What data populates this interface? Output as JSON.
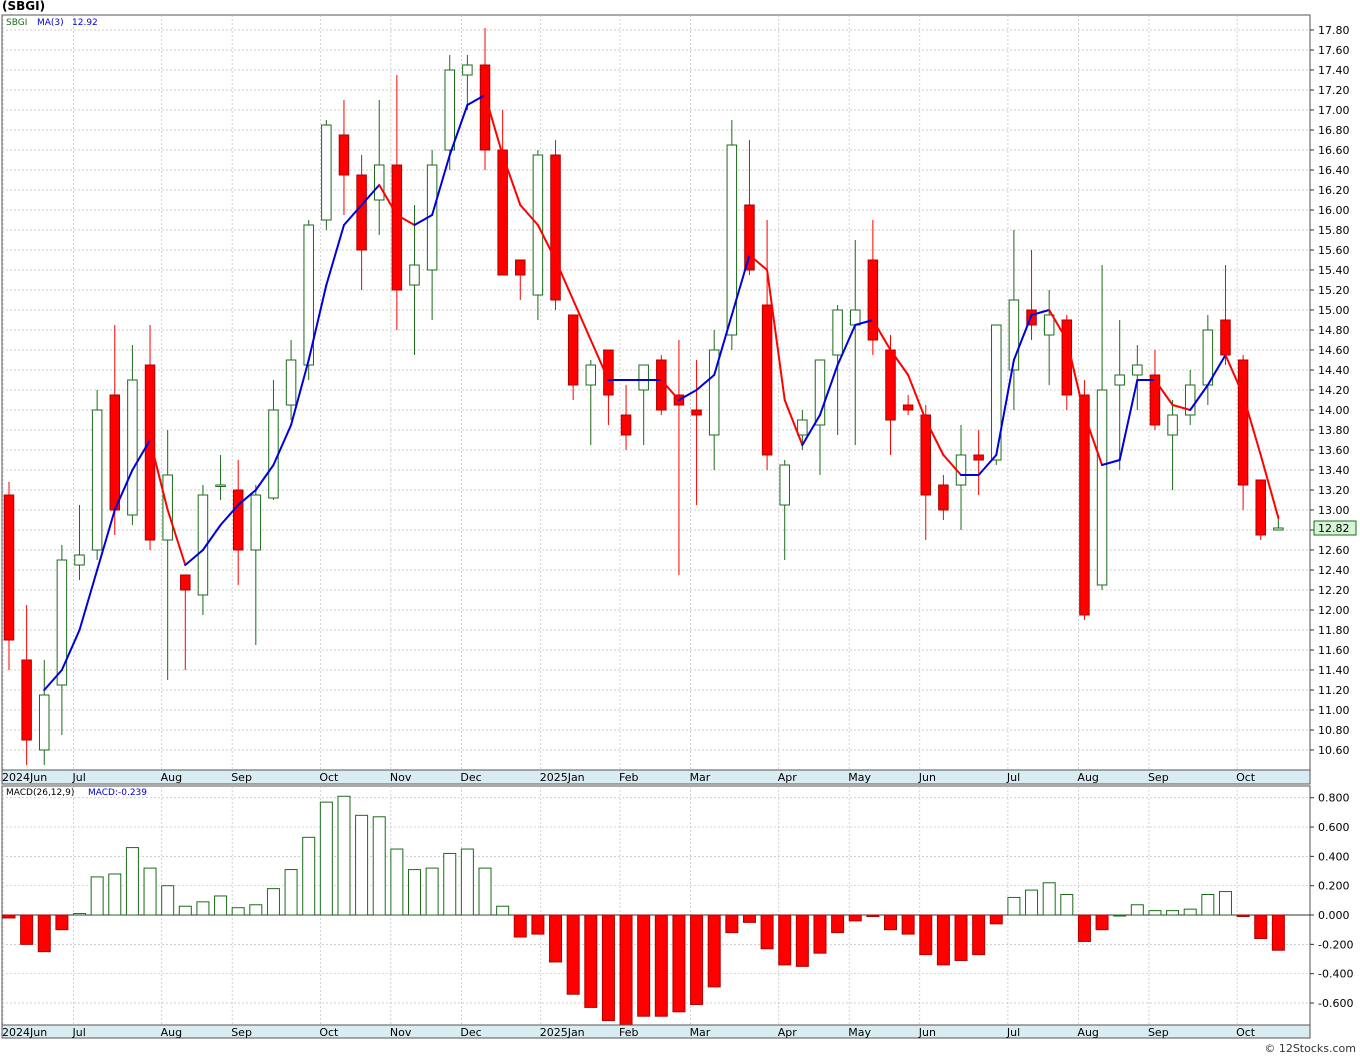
{
  "header": {
    "title": "(SBGI)"
  },
  "footer": {
    "credit": "© 12Stocks.com"
  },
  "colors": {
    "up": "#1b6b1b",
    "down": "#ff0000",
    "ma_up": "#0000dd",
    "ma_down": "#ff0000",
    "grid": "#bfbfbf",
    "axis_band": "#d9ecf2"
  },
  "chart_data": [
    {
      "type": "candlestick",
      "title": "",
      "legend": {
        "symbol": "SBGI",
        "indicator": "MA(3)",
        "value": "12.92"
      },
      "last_price_label": "12.82",
      "ylim": [
        10.4,
        17.95
      ],
      "y_ticks": [
        "10.60",
        "10.80",
        "11.00",
        "11.20",
        "11.40",
        "11.60",
        "11.80",
        "12.00",
        "12.20",
        "12.40",
        "12.60",
        "12.80",
        "13.00",
        "13.20",
        "13.40",
        "13.60",
        "13.80",
        "14.00",
        "14.20",
        "14.40",
        "14.60",
        "14.80",
        "15.00",
        "15.20",
        "15.40",
        "15.60",
        "15.80",
        "16.00",
        "16.20",
        "16.40",
        "16.60",
        "16.80",
        "17.00",
        "17.20",
        "17.40",
        "17.60",
        "17.80"
      ],
      "x_labels": [
        {
          "label": "2024Jun",
          "week": 0
        },
        {
          "label": "Jul",
          "week": 4
        },
        {
          "label": "Aug",
          "week": 9
        },
        {
          "label": "Sep",
          "week": 13
        },
        {
          "label": "Oct",
          "week": 18
        },
        {
          "label": "Nov",
          "week": 22
        },
        {
          "label": "Dec",
          "week": 26
        },
        {
          "label": "2025Jan",
          "week": 30.5
        },
        {
          "label": "Feb",
          "week": 35
        },
        {
          "label": "Mar",
          "week": 39
        },
        {
          "label": "Apr",
          "week": 44
        },
        {
          "label": "May",
          "week": 48
        },
        {
          "label": "Jun",
          "week": 52
        },
        {
          "label": "Jul",
          "week": 57
        },
        {
          "label": "Aug",
          "week": 61
        },
        {
          "label": "Sep",
          "week": 65
        },
        {
          "label": "Oct",
          "week": 70
        }
      ],
      "candles": [
        {
          "o": 13.15,
          "h": 13.28,
          "l": 11.4,
          "c": 11.7
        },
        {
          "o": 11.5,
          "h": 12.05,
          "l": 10.45,
          "c": 10.7
        },
        {
          "o": 10.6,
          "h": 11.5,
          "l": 10.45,
          "c": 11.15
        },
        {
          "o": 11.25,
          "h": 12.65,
          "l": 10.75,
          "c": 12.5
        },
        {
          "o": 12.45,
          "h": 13.05,
          "l": 12.3,
          "c": 12.55
        },
        {
          "o": 12.6,
          "h": 14.2,
          "l": 12.5,
          "c": 14.0
        },
        {
          "o": 14.15,
          "h": 14.85,
          "l": 12.75,
          "c": 13.0
        },
        {
          "o": 12.95,
          "h": 14.65,
          "l": 12.85,
          "c": 14.3
        },
        {
          "o": 14.45,
          "h": 14.85,
          "l": 12.6,
          "c": 12.7
        },
        {
          "o": 12.7,
          "h": 13.8,
          "l": 11.3,
          "c": 13.35
        },
        {
          "o": 12.35,
          "h": 12.35,
          "l": 11.4,
          "c": 12.2
        },
        {
          "o": 12.15,
          "h": 13.25,
          "l": 11.95,
          "c": 13.15
        },
        {
          "o": 13.25,
          "h": 13.55,
          "l": 13.1,
          "c": 13.25
        },
        {
          "o": 13.2,
          "h": 13.5,
          "l": 12.25,
          "c": 12.6
        },
        {
          "o": 12.6,
          "h": 13.25,
          "l": 11.65,
          "c": 13.15
        },
        {
          "o": 13.12,
          "h": 14.3,
          "l": 13.1,
          "c": 14.0
        },
        {
          "o": 14.05,
          "h": 14.7,
          "l": 13.9,
          "c": 14.5
        },
        {
          "o": 14.45,
          "h": 15.9,
          "l": 14.3,
          "c": 15.85
        },
        {
          "o": 15.9,
          "h": 16.9,
          "l": 15.8,
          "c": 16.85
        },
        {
          "o": 16.75,
          "h": 17.1,
          "l": 15.95,
          "c": 16.35
        },
        {
          "o": 16.35,
          "h": 16.55,
          "l": 15.2,
          "c": 15.6
        },
        {
          "o": 16.1,
          "h": 17.1,
          "l": 15.75,
          "c": 16.45
        },
        {
          "o": 16.45,
          "h": 17.35,
          "l": 14.8,
          "c": 15.2
        },
        {
          "o": 15.25,
          "h": 16.05,
          "l": 14.55,
          "c": 15.45
        },
        {
          "o": 15.4,
          "h": 16.6,
          "l": 14.9,
          "c": 16.45
        },
        {
          "o": 16.6,
          "h": 17.55,
          "l": 16.4,
          "c": 17.4
        },
        {
          "o": 17.35,
          "h": 17.55,
          "l": 17.0,
          "c": 17.45
        },
        {
          "o": 17.45,
          "h": 17.82,
          "l": 16.4,
          "c": 16.6
        },
        {
          "o": 16.6,
          "h": 17.0,
          "l": 15.35,
          "c": 15.35
        },
        {
          "o": 15.5,
          "h": 15.5,
          "l": 15.1,
          "c": 15.35
        },
        {
          "o": 15.15,
          "h": 16.6,
          "l": 14.9,
          "c": 16.55
        },
        {
          "o": 16.55,
          "h": 16.7,
          "l": 15.0,
          "c": 15.1
        },
        {
          "o": 14.95,
          "h": 14.95,
          "l": 14.1,
          "c": 14.25
        },
        {
          "o": 14.25,
          "h": 14.5,
          "l": 13.65,
          "c": 14.45
        },
        {
          "o": 14.6,
          "h": 14.6,
          "l": 13.85,
          "c": 14.15
        },
        {
          "o": 13.95,
          "h": 14.25,
          "l": 13.6,
          "c": 13.75
        },
        {
          "o": 14.2,
          "h": 14.45,
          "l": 13.65,
          "c": 14.45
        },
        {
          "o": 14.5,
          "h": 14.55,
          "l": 13.95,
          "c": 14.0
        },
        {
          "o": 14.15,
          "h": 14.7,
          "l": 12.35,
          "c": 14.05
        },
        {
          "o": 14.0,
          "h": 14.5,
          "l": 13.05,
          "c": 13.95
        },
        {
          "o": 13.75,
          "h": 14.8,
          "l": 13.4,
          "c": 14.6
        },
        {
          "o": 14.75,
          "h": 16.9,
          "l": 14.6,
          "c": 16.65
        },
        {
          "o": 16.05,
          "h": 16.7,
          "l": 15.35,
          "c": 15.4
        },
        {
          "o": 15.05,
          "h": 15.9,
          "l": 13.4,
          "c": 13.55
        },
        {
          "o": 13.05,
          "h": 13.5,
          "l": 12.5,
          "c": 13.45
        },
        {
          "o": 13.75,
          "h": 14.0,
          "l": 13.6,
          "c": 13.9
        },
        {
          "o": 13.85,
          "h": 14.5,
          "l": 13.35,
          "c": 14.5
        },
        {
          "o": 14.55,
          "h": 15.05,
          "l": 13.75,
          "c": 15.0
        },
        {
          "o": 14.85,
          "h": 15.7,
          "l": 13.65,
          "c": 15.0
        },
        {
          "o": 15.5,
          "h": 15.9,
          "l": 14.55,
          "c": 14.7
        },
        {
          "o": 14.6,
          "h": 14.75,
          "l": 13.55,
          "c": 13.9
        },
        {
          "o": 14.05,
          "h": 14.15,
          "l": 13.95,
          "c": 14.0
        },
        {
          "o": 13.95,
          "h": 14.05,
          "l": 12.7,
          "c": 13.15
        },
        {
          "o": 13.25,
          "h": 13.35,
          "l": 12.9,
          "c": 13.0
        },
        {
          "o": 13.25,
          "h": 13.85,
          "l": 12.8,
          "c": 13.55
        },
        {
          "o": 13.55,
          "h": 13.8,
          "l": 13.15,
          "c": 13.5
        },
        {
          "o": 13.5,
          "h": 14.3,
          "l": 13.45,
          "c": 14.85
        },
        {
          "o": 14.4,
          "h": 15.8,
          "l": 14.0,
          "c": 15.1
        },
        {
          "o": 15.0,
          "h": 15.6,
          "l": 14.7,
          "c": 14.85
        },
        {
          "o": 14.75,
          "h": 15.2,
          "l": 14.25,
          "c": 14.95
        },
        {
          "o": 14.9,
          "h": 14.95,
          "l": 14.0,
          "c": 14.15
        },
        {
          "o": 14.15,
          "h": 14.3,
          "l": 11.9,
          "c": 11.95
        },
        {
          "o": 12.25,
          "h": 15.45,
          "l": 12.2,
          "c": 14.2
        },
        {
          "o": 14.25,
          "h": 14.9,
          "l": 13.4,
          "c": 14.35
        },
        {
          "o": 14.35,
          "h": 14.65,
          "l": 14.0,
          "c": 14.45
        },
        {
          "o": 14.35,
          "h": 14.6,
          "l": 13.8,
          "c": 13.85
        },
        {
          "o": 13.75,
          "h": 14.1,
          "l": 13.2,
          "c": 13.95
        },
        {
          "o": 13.95,
          "h": 14.4,
          "l": 13.85,
          "c": 14.25
        },
        {
          "o": 14.25,
          "h": 14.95,
          "l": 14.05,
          "c": 14.8
        },
        {
          "o": 14.9,
          "h": 15.45,
          "l": 14.45,
          "c": 14.55
        },
        {
          "o": 14.5,
          "h": 14.55,
          "l": 13.0,
          "c": 13.25
        },
        {
          "o": 13.3,
          "h": 13.3,
          "l": 12.7,
          "c": 12.75
        },
        {
          "o": 12.8,
          "h": 12.95,
          "l": 12.8,
          "c": 12.82
        }
      ],
      "ma": [
        null,
        null,
        11.2,
        11.4,
        11.8,
        12.4,
        13.0,
        13.4,
        13.7,
        13.0,
        12.45,
        12.6,
        12.85,
        13.05,
        13.2,
        13.45,
        13.85,
        14.5,
        15.25,
        15.85,
        16.05,
        16.25,
        15.95,
        15.85,
        15.95,
        16.55,
        17.05,
        17.15,
        16.55,
        16.05,
        15.85,
        15.5,
        15.1,
        14.7,
        14.3,
        14.3,
        14.3,
        14.3,
        14.1,
        14.2,
        14.35,
        14.95,
        15.55,
        15.4,
        14.1,
        13.65,
        13.95,
        14.45,
        14.85,
        14.9,
        14.6,
        14.35,
        13.9,
        13.55,
        13.35,
        13.35,
        13.55,
        14.5,
        14.95,
        15.0,
        14.7,
        13.95,
        13.45,
        13.5,
        14.3,
        14.3,
        14.05,
        14.0,
        14.25,
        14.55,
        14.15,
        13.55,
        12.92
      ]
    },
    {
      "type": "bar",
      "title": "",
      "legend": {
        "indicator": "MACD(26,12,9)",
        "label": "MACD:",
        "value": "-0.239"
      },
      "ylim": [
        -0.75,
        0.88
      ],
      "y_ticks": [
        "0.800",
        "0.600",
        "0.400",
        "0.200",
        "0.000",
        "-0.200",
        "-0.400",
        "-0.600"
      ],
      "values": [
        -0.02,
        -0.2,
        -0.25,
        -0.1,
        0.01,
        0.26,
        0.28,
        0.46,
        0.32,
        0.2,
        0.06,
        0.09,
        0.13,
        0.05,
        0.07,
        0.18,
        0.31,
        0.53,
        0.77,
        0.81,
        0.68,
        0.67,
        0.45,
        0.31,
        0.32,
        0.42,
        0.45,
        0.32,
        0.06,
        -0.15,
        -0.13,
        -0.32,
        -0.54,
        -0.63,
        -0.72,
        -0.75,
        -0.69,
        -0.69,
        -0.66,
        -0.61,
        -0.49,
        -0.12,
        -0.05,
        -0.23,
        -0.34,
        -0.35,
        -0.26,
        -0.12,
        -0.04,
        -0.01,
        -0.1,
        -0.13,
        -0.27,
        -0.34,
        -0.31,
        -0.27,
        -0.06,
        0.12,
        0.17,
        0.22,
        0.14,
        -0.18,
        -0.1,
        0.0,
        0.07,
        0.03,
        0.03,
        0.04,
        0.14,
        0.16,
        -0.01,
        -0.16,
        -0.24
      ]
    }
  ]
}
